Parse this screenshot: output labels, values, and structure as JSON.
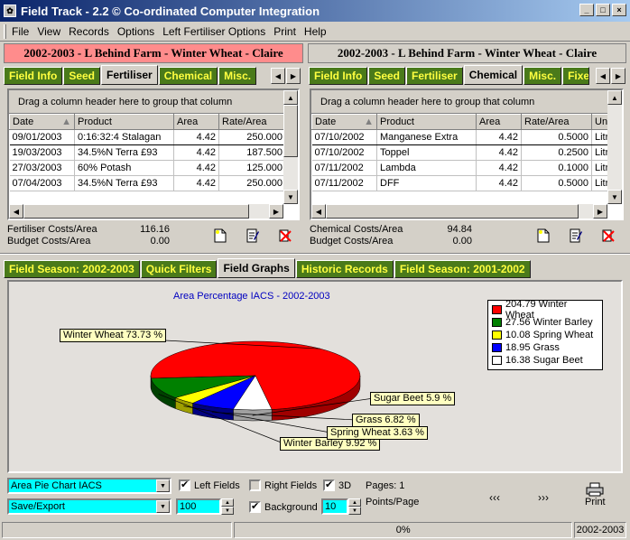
{
  "window": {
    "title": "Field Track - 2.2 © Co-ordinated Computer Integration"
  },
  "menu": [
    "File",
    "View",
    "Records",
    "Options",
    "Left Fertiliser Options",
    "Print",
    "Help"
  ],
  "left_panel": {
    "header": "2002-2003 - L Behind Farm - Winter Wheat - Claire",
    "header_color": "#ff8c8c",
    "tabs": [
      "Field Info",
      "Seed",
      "Fertiliser",
      "Chemical",
      "Misc."
    ],
    "active_tab": "Fertiliser",
    "drag_hint": "Drag a column header here to group that column",
    "columns": [
      "Date",
      "Product",
      "Area",
      "Rate/Area"
    ],
    "rows": [
      [
        "09/01/2003",
        "0:16:32:4 Stalagan",
        "4.42",
        "250.000"
      ],
      [
        "19/03/2003",
        "34.5%N Terra £93",
        "4.42",
        "187.500"
      ],
      [
        "27/03/2003",
        "60% Potash",
        "4.42",
        "125.000"
      ],
      [
        "07/04/2003",
        "34.5%N Terra £93",
        "4.42",
        "250.000"
      ]
    ],
    "costs": [
      {
        "label": "Fertiliser Costs/Area",
        "value": "116.16"
      },
      {
        "label": "Budget Costs/Area",
        "value": "0.00"
      }
    ]
  },
  "right_panel": {
    "header": "2002-2003 - L Behind Farm - Winter Wheat - Claire",
    "header_color": "#d4d0c8",
    "tabs": [
      "Field Info",
      "Seed",
      "Fertiliser",
      "Chemical",
      "Misc.",
      "Fixe"
    ],
    "active_tab": "Chemical",
    "drag_hint": "Drag a column header here to group that column",
    "columns": [
      "Date",
      "Product",
      "Area",
      "Rate/Area",
      "Un"
    ],
    "rows": [
      [
        "07/10/2002",
        "Manganese Extra",
        "4.42",
        "0.5000",
        "Litr"
      ],
      [
        "07/10/2002",
        "Toppel",
        "4.42",
        "0.2500",
        "Litr"
      ],
      [
        "07/11/2002",
        "Lambda",
        "4.42",
        "0.1000",
        "Litr"
      ],
      [
        "07/11/2002",
        "DFF",
        "4.42",
        "0.5000",
        "Litr"
      ]
    ],
    "costs": [
      {
        "label": "Chemical Costs/Area",
        "value": "94.84"
      },
      {
        "label": "Budget Costs/Area",
        "value": "0.00"
      }
    ]
  },
  "bottom_tabs": [
    "Field Season: 2002-2003",
    "Quick Filters",
    "Field Graphs",
    "Historic Records",
    "Field Season: 2001-2002"
  ],
  "bottom_active": "Field Graphs",
  "chart_data": {
    "type": "pie",
    "title": "Area Percentage IACS - 2002-2003",
    "three_d": true,
    "legend_position": "top-right",
    "categories": [
      "Winter Wheat",
      "Winter Barley",
      "Spring Wheat",
      "Grass",
      "Sugar Beet"
    ],
    "values": [
      204.79,
      27.56,
      10.08,
      18.95,
      16.38
    ],
    "percentages": [
      73.73,
      9.92,
      3.63,
      6.82,
      5.9
    ],
    "colors": [
      "#ff0000",
      "#008000",
      "#ffff00",
      "#0000ff",
      "#ffffff"
    ],
    "legend_labels": [
      "204.79 Winter Wheat",
      "27.56 Winter Barley",
      "10.08 Spring Wheat",
      "18.95 Grass",
      "16.38 Sugar Beet"
    ],
    "slice_labels": [
      "Winter Wheat 73.73 %",
      "Winter Barley 9.92 %",
      "Spring Wheat 3.63 %",
      "Grass 6.82 %",
      "Sugar Beet 5.9 %"
    ]
  },
  "controls": {
    "graph_type": "Area Pie Chart IACS",
    "save_export": "Save/Export",
    "zoom": "100",
    "points_value": "10",
    "left_fields": {
      "label": "Left Fields",
      "checked": true
    },
    "right_fields": {
      "label": "Right Fields",
      "checked": false
    },
    "three_d": {
      "label": "3D",
      "checked": true
    },
    "background": {
      "label": "Background",
      "checked": true
    },
    "pages": "Pages: 1",
    "points_per_page": "Points/Page",
    "prev": "‹‹‹",
    "next": "›››",
    "print": "Print"
  },
  "status": {
    "progress": "0%",
    "season": "2002-2003"
  }
}
